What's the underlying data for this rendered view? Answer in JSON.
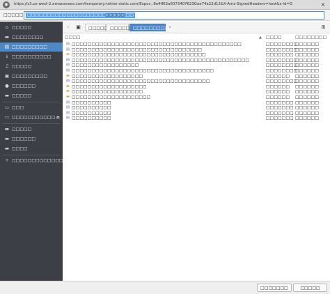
{
  "window": {
    "title": "https://s3.us-west-2.amazonaws.com/temporary.notion-static.com/Expor...8e4ff62a6073407623Gae74a22d12&X-Amz-SignedHeaders=host&x-id=GetObject",
    "app_icon": "app-icon",
    "close_glyph": "×"
  },
  "location": {
    "label": "□□□□□",
    "selected_text": "□□□□□□□□□□□□□□□□□□□□□□□□□□□",
    "rest_text": "□□□□□"
  },
  "sidebar": {
    "items": [
      {
        "icon": "⌂",
        "icon_name": "home-icon",
        "label": "□□□□□"
      },
      {
        "icon": "▬",
        "icon_name": "folder-icon",
        "label": "□□□□□□□□"
      },
      {
        "icon": "▤",
        "icon_name": "documents-icon",
        "label": "□□□□□□□□□"
      },
      {
        "icon": "↓",
        "icon_name": "download-icon",
        "label": "□□□□□□□□□□"
      },
      {
        "icon": "♫",
        "icon_name": "music-icon",
        "label": "□□□□□"
      },
      {
        "icon": "▣",
        "icon_name": "pictures-icon",
        "label": "□□□□□□□□□"
      },
      {
        "icon": "●",
        "icon_name": "videos-icon",
        "label": "□□□□□□"
      },
      {
        "icon": "▬",
        "icon_name": "trash-icon",
        "label": "□□□□□"
      },
      {
        "icon": "▭",
        "icon_name": "computer-icon",
        "label": "□□□"
      },
      {
        "icon": "▭",
        "icon_name": "drive-icon",
        "label": "□□□□□□□□□□□",
        "eject": "⏏"
      },
      {
        "icon": "▬",
        "icon_name": "folder-icon",
        "label": "□□□□□"
      },
      {
        "icon": "▬",
        "icon_name": "folder-icon",
        "label": "□□□□□□"
      },
      {
        "icon": "▬",
        "icon_name": "folder-icon",
        "label": "□□□□"
      },
      {
        "icon": "+",
        "icon_name": "plus-icon",
        "label": "□□□□□□□□□□□□□□□□□"
      }
    ]
  },
  "pathbar": {
    "left_arrow": "‹",
    "right_arrow": "›",
    "drive_glyph": "▣",
    "crumbs": [
      "□□□□□",
      "□□□□□□",
      "□□□□□□□□□□□"
    ],
    "newfolder_glyph": "⊞"
  },
  "filelist": {
    "headers": {
      "name": "□□□□",
      "sort": "▲",
      "size": "□□□□",
      "date": "□□□□□□□□"
    },
    "rows": [
      {
        "icon": "doc",
        "name": "□□□□□□□□□□□□□□□□□□□□□□□□□□□□□□□□□□□□□□□□□□□",
        "size": "□□□□□□□□",
        "date": "□□□□□□"
      },
      {
        "icon": "doc",
        "name": "□□□□□□□□□□□□□□□□□□□□□□□□□□□□□□□□□",
        "size": "□□□□□□□□",
        "date": "□□□□□□"
      },
      {
        "icon": "folder",
        "name": "□□□□□□□□□□□□□□□□□□□□□□□□□□□□□□□□□□",
        "size": "□□□□□□□",
        "date": "□□□□□□"
      },
      {
        "icon": "doc",
        "name": "□□□□□□□□□□□□□□□□□□□□□□□□□□□□□□□□□□□□□□□□□□□□□",
        "size": "□□□□□□□□",
        "date": "□□□□□□"
      },
      {
        "icon": "doc",
        "name": "□□□□□□□□□□□□□□□□□",
        "size": "□□□□□□□□",
        "date": "□□□□□□"
      },
      {
        "icon": "doc",
        "name": "□□□□□□□□□□□□□□□□□□□□□□□□□□□□□□□□□□□□",
        "size": "□□□□□□□□",
        "date": "□□□□□□"
      },
      {
        "icon": "folder",
        "name": "□□□□□□□□□□□□□□□□□□",
        "size": "□□□□□□",
        "date": "□□□□□□"
      },
      {
        "icon": "doc",
        "name": "□□□□□□□□□□□□□□□□□□□□□□□□□□□□□□□□□□□",
        "size": "□□□□□□□□",
        "date": "□□□□□□"
      },
      {
        "icon": "folder",
        "name": "□□□□□□□□□□□□□□□□□□□",
        "size": "□□□□□□",
        "date": "□□□□□□"
      },
      {
        "icon": "folder",
        "name": "□□□□□□□□□□□□□□□□□□",
        "size": "□□□□□□",
        "date": "□□□□□□"
      },
      {
        "icon": "folder",
        "name": "□□□□□□□□□□□□□□□□□□□□",
        "size": "□□□□□□",
        "date": "□□□□□□"
      },
      {
        "icon": "doc",
        "name": "□□□□□□□□□□",
        "size": "□□□□□□□",
        "date": "□□□□□□"
      },
      {
        "icon": "doc",
        "name": "□□□□□□□□□□",
        "size": "□□□□□□□",
        "date": "□□□□□□"
      },
      {
        "icon": "doc",
        "name": "□□□□□□□□□□",
        "size": "□□□□□□□",
        "date": "□□□□□□"
      },
      {
        "icon": "doc",
        "name": "□□□□□□□□□□",
        "size": "□□□□□□□",
        "date": "□□□□□□"
      }
    ]
  },
  "footer": {
    "cancel_label": "□□□□□□□",
    "open_label": "□□□□□"
  },
  "colors": {
    "sidebar_bg": "#3c3f46",
    "accent": "#4f88c6",
    "folder": "#d5a63c"
  }
}
